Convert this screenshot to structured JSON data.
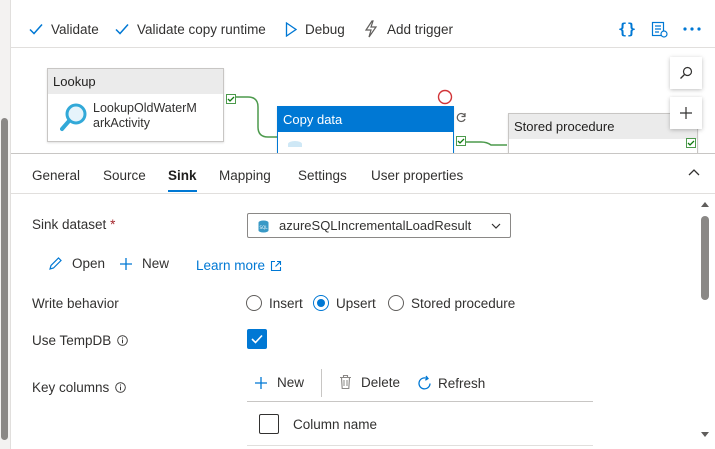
{
  "toolbar": {
    "validate": "Validate",
    "validate_copy_runtime": "Validate copy runtime",
    "debug": "Debug",
    "add_trigger": "Add trigger",
    "icons": [
      "code-icon",
      "properties-icon",
      "more-icon"
    ]
  },
  "canvas": {
    "lookup": {
      "title": "Lookup",
      "name_line1": "LookupOldWaterM",
      "name_line2": "arkActivity"
    },
    "copy": {
      "title": "Copy data"
    },
    "stored": {
      "title": "Stored procedure"
    },
    "colors": {
      "selected": "#0078d4",
      "success": "#107c10",
      "error": "#d13438"
    }
  },
  "tabs": {
    "items": [
      {
        "label": "General"
      },
      {
        "label": "Source"
      },
      {
        "label": "Sink"
      },
      {
        "label": "Mapping"
      },
      {
        "label": "Settings"
      },
      {
        "label": "User properties"
      }
    ],
    "active": "Sink"
  },
  "sink": {
    "dataset_label": "Sink dataset",
    "required_mark": "*",
    "dataset_value": "azureSQLIncrementalLoadResult",
    "open": "Open",
    "new": "New",
    "learn_more": "Learn more",
    "write_behavior_label": "Write behavior",
    "write_options": [
      "Insert",
      "Upsert",
      "Stored procedure"
    ],
    "write_selected": "Upsert",
    "use_tempdb_label": "Use TempDB",
    "use_tempdb_checked": true,
    "key_columns_label": "Key columns",
    "key_new": "New",
    "key_delete": "Delete",
    "key_refresh": "Refresh",
    "column_header": "Column name"
  }
}
